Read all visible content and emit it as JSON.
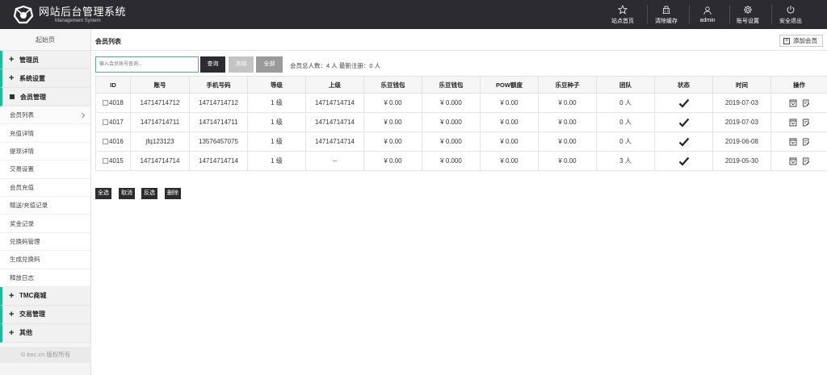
{
  "header": {
    "title": "网站后台管理系统",
    "subtitle": "Management System",
    "nav": [
      {
        "label": "站点首页",
        "icon": "star-icon"
      },
      {
        "label": "清除缓存",
        "icon": "building-icon"
      },
      {
        "label": "admin",
        "icon": "user-icon"
      },
      {
        "label": "账号设置",
        "icon": "gear-icon"
      },
      {
        "label": "安全退出",
        "icon": "power-icon"
      }
    ]
  },
  "sidebar": {
    "top_label": "起始页",
    "sections": {
      "admin": "管理员",
      "system": "系统设置",
      "member": "会员管理",
      "tmc": "TMC商城",
      "trade": "交易管理",
      "other": "其他"
    },
    "member_items": [
      "会员列表",
      "充值详情",
      "提现详情",
      "交易设置",
      "会员充值",
      "赠送/充值记录",
      "奖金记录",
      "兑换码管理",
      "生成兑换码",
      "释放日志"
    ],
    "footer": "© tmc.cn 版权所有"
  },
  "main": {
    "page_title": "会员列表",
    "add_button": "添加会员",
    "search_placeholder": "输入会员账号查询...",
    "btn_query": "查询",
    "btn_freeze": "冻结",
    "btn_all": "全部",
    "stats": "会员总人数：4 人 最新注册：0 人",
    "columns": [
      "ID",
      "账号",
      "手机号码",
      "等级",
      "上级",
      "乐豆钱包",
      "乐豆钱包",
      "POW额度",
      "乐豆种子",
      "团队",
      "状态",
      "时间",
      "操作"
    ],
    "rows": [
      {
        "id": "4018",
        "account": "14714714712",
        "phone": "14714714712",
        "level": "1 级",
        "parent": "14714714714",
        "wallet1": "¥ 0.00",
        "wallet2": "¥ 0.000",
        "pow": "¥ 0.00",
        "seed": "¥ 0.00",
        "team": "0 人",
        "date": "2019-07-03"
      },
      {
        "id": "4017",
        "account": "14714714711",
        "phone": "14714714711",
        "level": "1 级",
        "parent": "14714714714",
        "wallet1": "¥ 0.00",
        "wallet2": "¥ 0.000",
        "pow": "¥ 0.00",
        "seed": "¥ 0.00",
        "team": "0 人",
        "date": "2019-07-03"
      },
      {
        "id": "4016",
        "account": "jfq123123",
        "phone": "13576457075",
        "level": "1 级",
        "parent": "14714714714",
        "wallet1": "¥ 0.00",
        "wallet2": "¥ 0.000",
        "pow": "¥ 0.00",
        "seed": "¥ 0.00",
        "team": "0 人",
        "date": "2019-06-08"
      },
      {
        "id": "4015",
        "account": "14714714714",
        "phone": "14714714714",
        "level": "1 级",
        "parent": "--",
        "wallet1": "¥ 0.00",
        "wallet2": "¥ 0.000",
        "pow": "¥ 0.00",
        "seed": "¥ 0.00",
        "team": "3 人",
        "date": "2019-05-30"
      }
    ],
    "bulk": {
      "select_all": "全选",
      "cancel": "取消",
      "invert": "反选",
      "delete": "删除"
    }
  }
}
